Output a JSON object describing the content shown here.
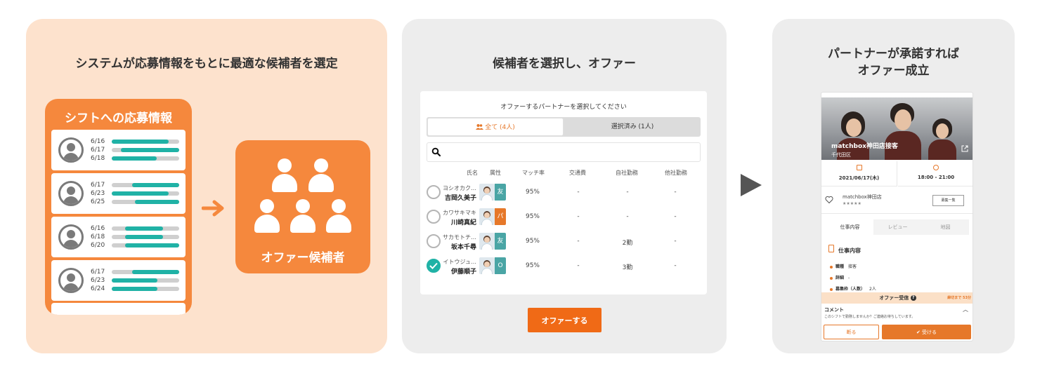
{
  "panel1": {
    "title": "システムが応募情報をもとに最適な候補者を選定",
    "shift_card_title": "シフトへの応募情報",
    "applicants": [
      {
        "rows": [
          {
            "date": "6/16",
            "fill": [
              0.0,
              0.84
            ]
          },
          {
            "date": "6/17",
            "fill": [
              0.14,
              1.0
            ]
          },
          {
            "date": "6/18",
            "fill": [
              0.0,
              0.67
            ]
          }
        ]
      },
      {
        "rows": [
          {
            "date": "6/17",
            "fill": [
              0.3,
              1.0
            ]
          },
          {
            "date": "6/23",
            "fill": [
              0.0,
              0.84
            ]
          },
          {
            "date": "6/25",
            "fill": [
              0.34,
              1.0
            ]
          }
        ]
      },
      {
        "rows": [
          {
            "date": "6/16",
            "fill": [
              0.2,
              0.76
            ]
          },
          {
            "date": "6/18",
            "fill": [
              0.2,
              0.76
            ]
          },
          {
            "date": "6/20",
            "fill": [
              0.2,
              1.0
            ]
          }
        ]
      },
      {
        "rows": [
          {
            "date": "6/17",
            "fill": [
              0.3,
              1.0
            ]
          },
          {
            "date": "6/23",
            "fill": [
              0.0,
              0.68
            ]
          },
          {
            "date": "6/24",
            "fill": [
              0.0,
              0.68
            ]
          }
        ]
      }
    ],
    "candidate_label": "オファー候補者",
    "colors": {
      "panel_bg": "#fde2cd",
      "card": "#f5883d",
      "bar_fill": "#20b2a6",
      "bar_track": "#cfcfcf"
    }
  },
  "panel2": {
    "title": "候補者を選択し、オファー",
    "card_title": "オファーするパートナーを選択してください",
    "tab_all": "全て (4人)",
    "tab_selected": "選択済み (1人)",
    "search_icon": "search-icon",
    "columns": [
      "氏名",
      "属性",
      "マッチ率",
      "交通費",
      "自社勤務",
      "他社勤務"
    ],
    "rows": [
      {
        "kana": "ヨシオカク…",
        "name": "吉岡久美子",
        "attr": "友",
        "attr_type": "t",
        "match": "95%",
        "transport": "-",
        "own": "-",
        "other": "-",
        "checked": false
      },
      {
        "kana": "カワサキマキ",
        "name": "川崎真紀",
        "attr": "パ",
        "attr_type": "p",
        "match": "95%",
        "transport": "-",
        "own": "-",
        "other": "-",
        "checked": false
      },
      {
        "kana": "サカモトチ…",
        "name": "坂本千尋",
        "attr": "友",
        "attr_type": "t",
        "match": "95%",
        "transport": "-",
        "own": "2勤",
        "other": "-",
        "checked": false
      },
      {
        "kana": "イトウジュ…",
        "name": "伊藤順子",
        "attr": "O",
        "attr_type": "t",
        "match": "95%",
        "transport": "-",
        "own": "3勤",
        "other": "-",
        "checked": true
      }
    ],
    "offer_button": "オファーする",
    "colors": {
      "accent": "#f06a16",
      "tab_active": "#e6782a",
      "check": "#20b2a6"
    }
  },
  "panel3": {
    "title_line1": "パートナーが承諾すれば",
    "title_line2": "オファー成立",
    "hero_title": "matchbox神田店接客",
    "hero_sub": "千代田区",
    "date": "2021/06/17(木)",
    "time": "18:00 - 21:00",
    "store_name": "matchbox神田店",
    "stars": "★★★★★",
    "work_list_button": "募集一覧",
    "tabs": [
      "仕事内容",
      "レビュー",
      "地図"
    ],
    "section_title": "仕事内容",
    "details": [
      {
        "key": "職種",
        "value": "接客"
      },
      {
        "key": "詳細",
        "value": "-"
      },
      {
        "key": "募集枠（人数）",
        "value": "2人"
      }
    ],
    "offer_bar_label": "オファー受信",
    "offer_bar_time": "締切まで 53分",
    "comment_title": "コメント",
    "comment_text": "このシフトで勤務しませんか？ご連絡お待ちしています。",
    "decline_button": "断る",
    "accept_button": "受ける",
    "colors": {
      "accent": "#e6782a"
    }
  }
}
